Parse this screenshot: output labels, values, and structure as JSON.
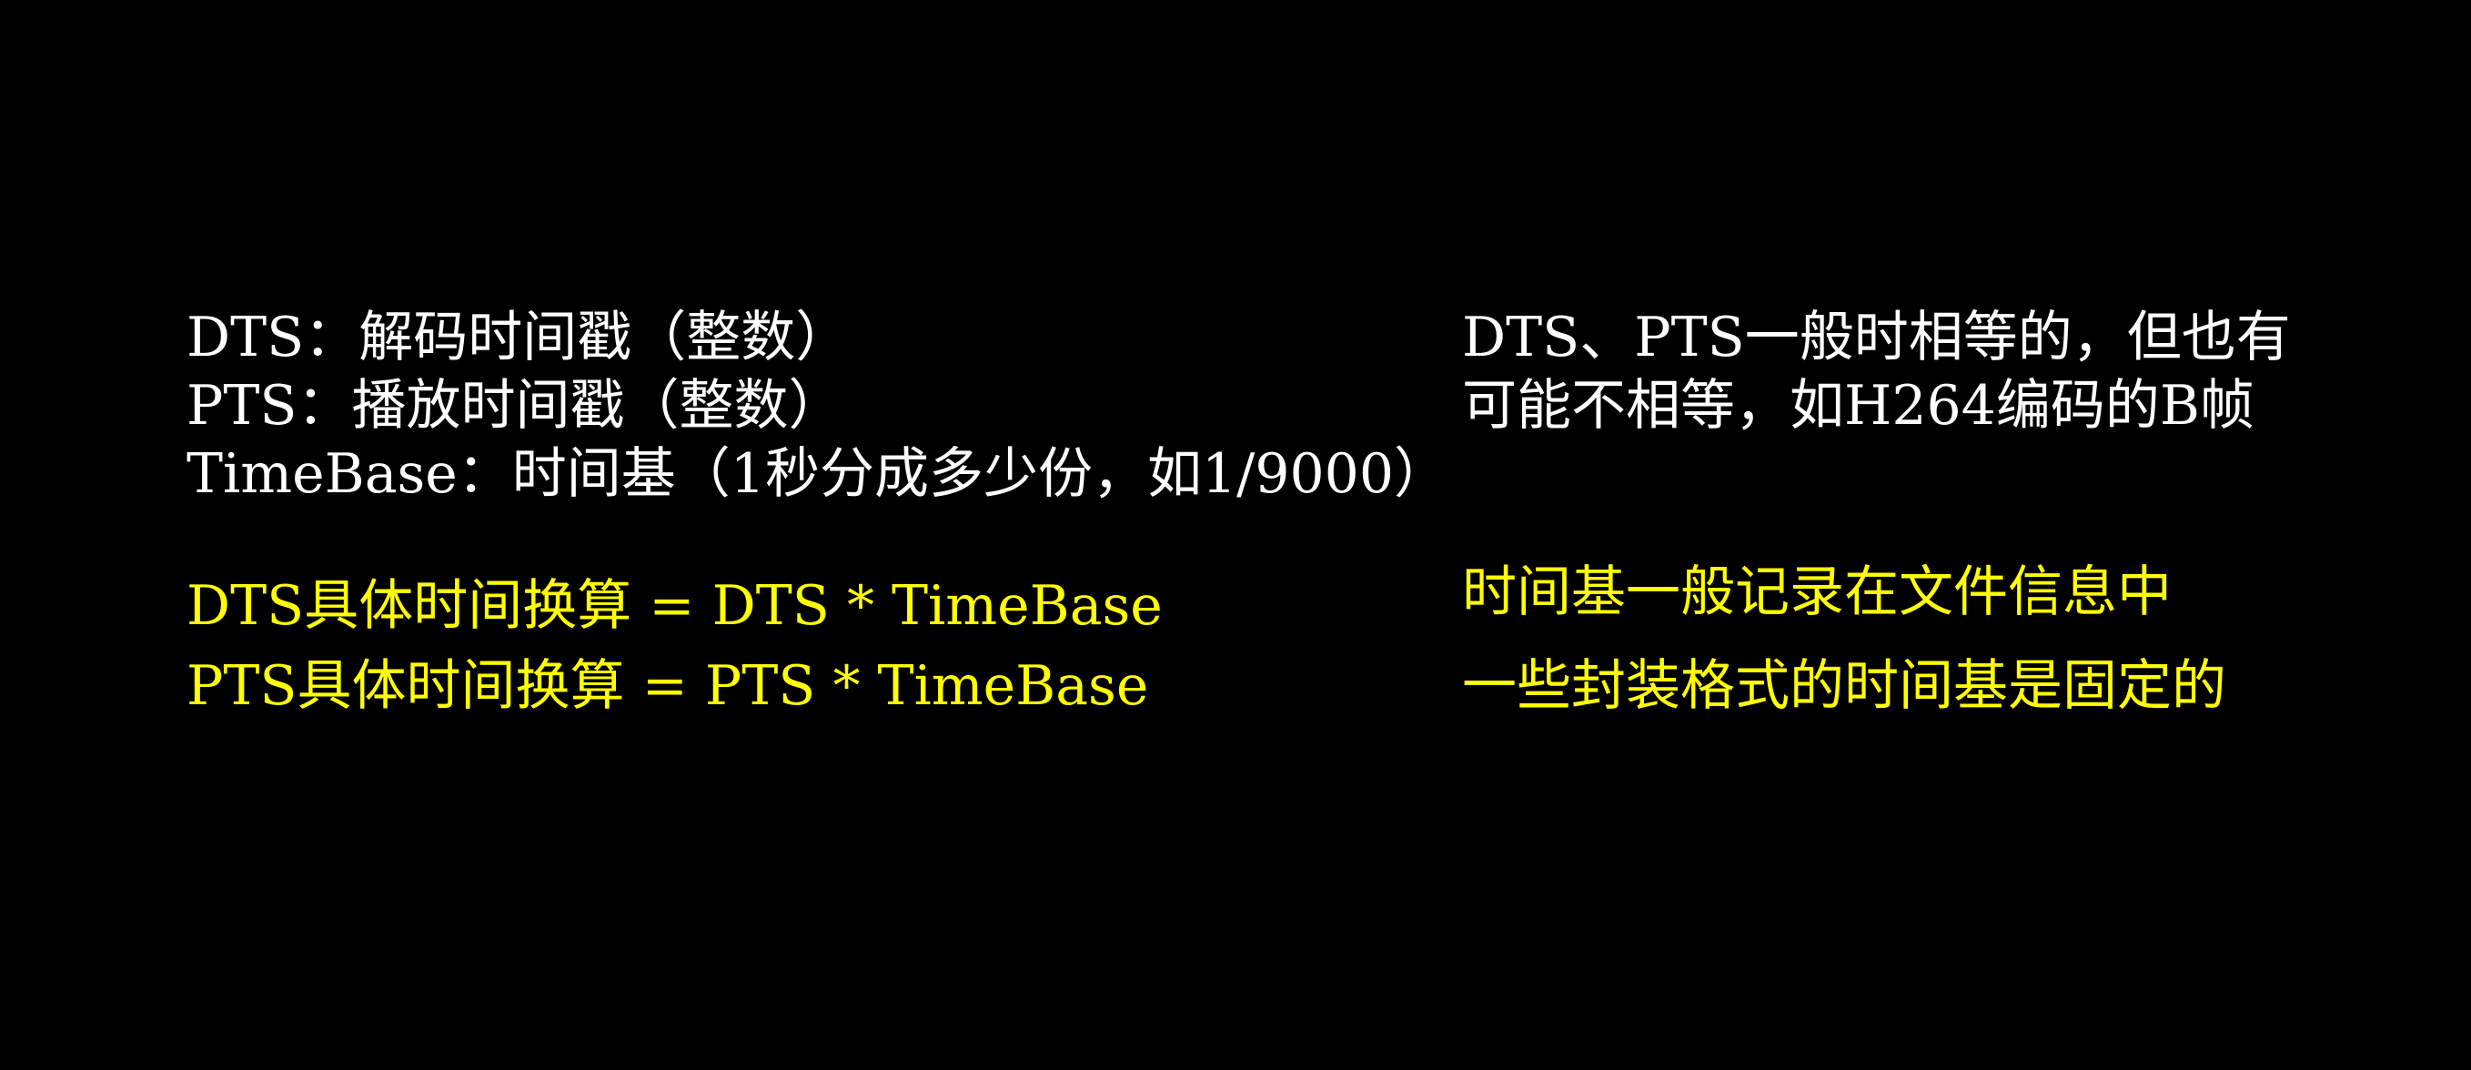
{
  "colors": {
    "background": "#000000",
    "primary_text": "#ffffff",
    "highlight_text": "#ffff00"
  },
  "left": {
    "definitions": [
      "DTS：解码时间戳（整数）",
      "PTS：播放时间戳（整数）",
      "TimeBase：时间基（1秒分成多少份，如1/9000）"
    ],
    "formulas": [
      "DTS具体时间换算 = DTS * TimeBase",
      "PTS具体时间换算 = PTS * TimeBase"
    ]
  },
  "right": {
    "notes_white": [
      "DTS、PTS一般时相等的，但也有",
      "可能不相等，如H264编码的B帧"
    ],
    "notes_yellow": [
      "时间基一般记录在文件信息中",
      "一些封装格式的时间基是固定的"
    ]
  }
}
